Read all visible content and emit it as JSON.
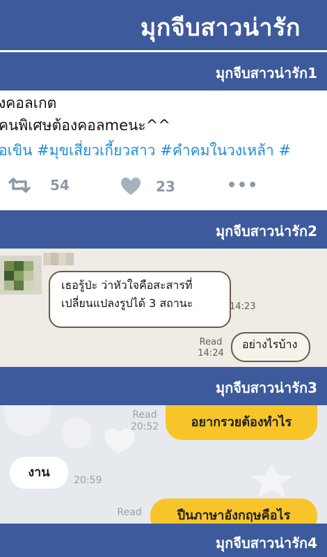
{
  "app": {
    "title": "มุกจีบสาวน่ารัก"
  },
  "sections": [
    {
      "label": "มุกจีบสาวน่ารัก1"
    },
    {
      "label": "มุกจีบสาวน่ารัก2"
    },
    {
      "label": "มุกจีบสาวน่ารัก3"
    },
    {
      "label": "มุกจีบสาวน่ารัก4"
    }
  ],
  "tweet": {
    "line1": "งคอลเกต",
    "line2": "คนพิเศษต้องคอลmeนะ^^",
    "hashtags": "อเขิน #มุขเสี่ยวเกี้ยวสาว #คำคมในวงเหล้า #",
    "retweet_count": "54",
    "like_count": "23",
    "more": "•••"
  },
  "chat1": {
    "received_text_1": "เธอรู้ป่ะ ว่าหัวใจคือสะสารที่",
    "received_text_2": "เปลี่ยนแปลงรูปได้ 3 สถานะ",
    "received_time": "14:23",
    "sent_status": "Read",
    "sent_time": "14:24",
    "sent_text": "อย่างไรบ้าง"
  },
  "chat2": {
    "sent1_status": "Read",
    "sent1_time": "20:52",
    "sent1_text": "อยากรวยต้องทำไร",
    "received_text": "งาน",
    "received_time": "20:59",
    "sent2_status": "Read",
    "sent2_text": "ปืนภาษาอังกฤษคือไร"
  },
  "colors": {
    "header_blue": "#3d5a9c",
    "hashtag_blue": "#1d8ed8",
    "line_yellow": "#f7c52a"
  }
}
